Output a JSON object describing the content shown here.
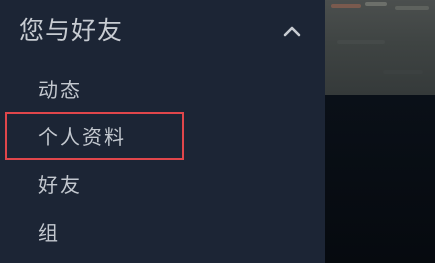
{
  "sidebar": {
    "section_title": "您与好友",
    "section_expanded": true,
    "items": [
      {
        "label": "动态"
      },
      {
        "label": "个人资料",
        "highlighted": true
      },
      {
        "label": "好友"
      },
      {
        "label": "组"
      }
    ]
  },
  "icons": {
    "collapse": "chevron-up-icon"
  },
  "colors": {
    "sidebar_bg": "#1c2535",
    "text": "#c3c8cf",
    "highlight_border": "#e0464b",
    "content_bg": "#070b10"
  }
}
